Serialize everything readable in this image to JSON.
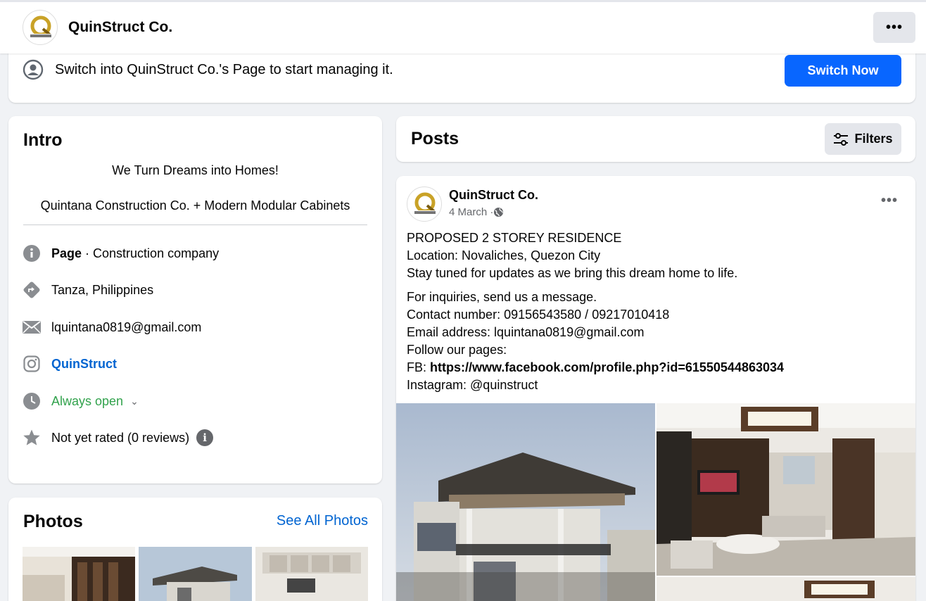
{
  "header": {
    "page_name": "QuinStruct Co.",
    "more_label": "•••"
  },
  "switch_banner": {
    "text": "Switch into QuinStruct Co.'s Page to start managing it.",
    "button_label": "Switch Now"
  },
  "intro": {
    "title": "Intro",
    "bio_line1": "We Turn Dreams into Homes!",
    "bio_line2": "Quintana Construction Co. + Modern Modular Cabinets",
    "page_label": "Page",
    "category": " · Construction company",
    "location": "Tanza, Philippines",
    "email": "lquintana0819@gmail.com",
    "instagram": "QuinStruct",
    "hours": "Always open",
    "rating": "Not yet rated (0 reviews)"
  },
  "photos": {
    "title": "Photos",
    "see_all": "See All Photos"
  },
  "posts": {
    "title": "Posts",
    "filters_label": "Filters"
  },
  "post": {
    "author": "QuinStruct Co.",
    "date": "4 March · ",
    "more_label": "•••",
    "lines_a": [
      "PROPOSED 2 STOREY RESIDENCE",
      "Location: Novaliches, Quezon City",
      "Stay tuned for updates as we bring this dream home to life."
    ],
    "lines_b": [
      "For inquiries, send us a message.",
      "Contact number: 09156543580 / 09217010418",
      "Email address: lquintana0819@gmail.com",
      "Follow our pages:"
    ],
    "fb_prefix": "FB: ",
    "fb_link": "https://www.facebook.com/profile.php?id=61550544863034",
    "instagram_line": "Instagram: @quinstruct"
  },
  "colors": {
    "primary_blue": "#0866ff",
    "link_blue": "#0064d1",
    "open_green": "#31a24c",
    "background": "#f0f2f5"
  }
}
